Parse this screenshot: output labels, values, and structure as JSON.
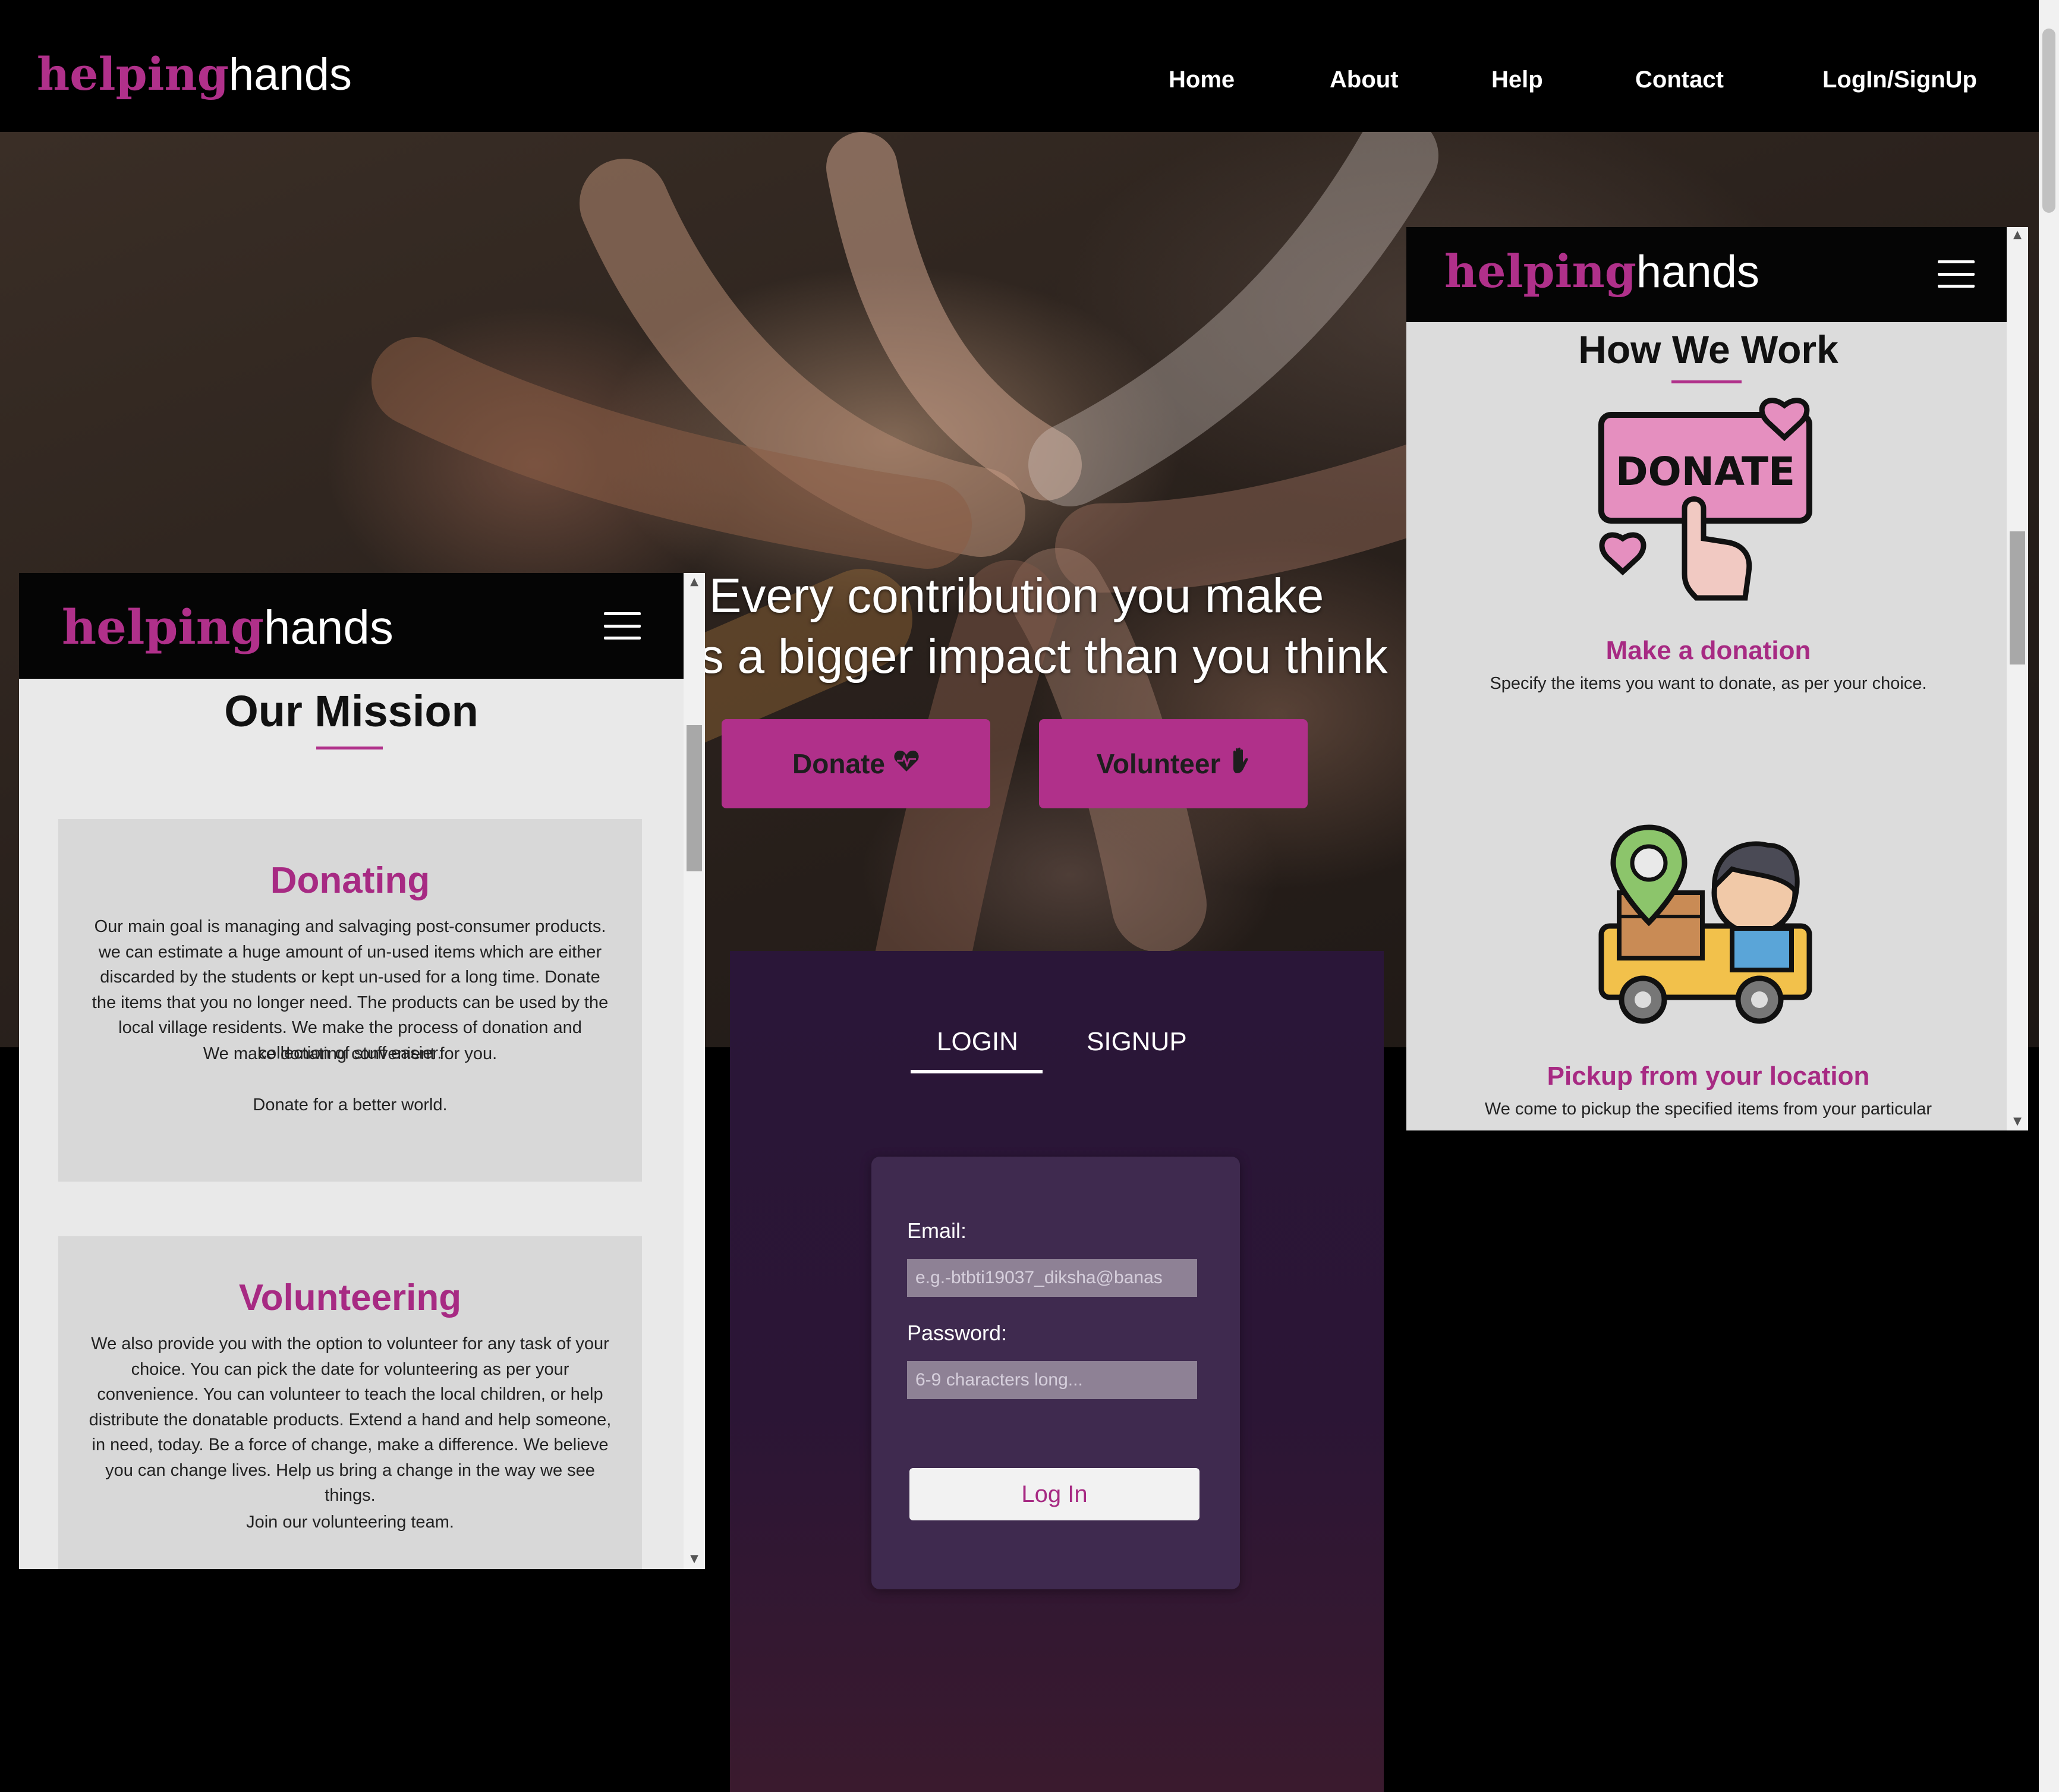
{
  "site": {
    "logo_part1": "helping",
    "logo_part2": "hands"
  },
  "nav": {
    "home": "Home",
    "about": "About",
    "help": "Help",
    "contact": "Contact",
    "login_signup": "LogIn/SignUp"
  },
  "hero": {
    "title_line1": "Every contribution you make",
    "title_line2": "has a bigger impact than you think",
    "donate_label": "Donate",
    "donate_icon": "heartbeat-icon",
    "volunteer_label": "Volunteer",
    "volunteer_icon": "raised-hand-icon"
  },
  "mission": {
    "title": "Our Mission",
    "cards": [
      {
        "title": "Donating",
        "body": "Our main goal is managing and salvaging post-consumer products. we can estimate a huge amount of un-used items which are either discarded by the students or kept un-used for a long time. Donate the items that you no longer need. The products can be used by the local village residents. We make the process of donation and collection of stuff easier.",
        "line2": "We make donating convenient for you.",
        "line3": "Donate for a better world."
      },
      {
        "title": "Volunteering",
        "body": "We also provide you with the option to volunteer for any task of your choice. You can pick the date for volunteering as per your convenience. You can volunteer to teach the local children, or help distribute the donatable products. Extend a hand and help someone, in need, today. Be a force of change, make a difference. We believe you can change lives. Help us bring a change in the way we see things.",
        "line3": "Join our volunteering team."
      }
    ]
  },
  "login": {
    "tab_login": "LOGIN",
    "tab_signup": "SIGNUP",
    "email_label": "Email:",
    "email_placeholder": "e.g.-btbti19037_diksha@banas",
    "password_label": "Password:",
    "password_placeholder": "6-9 characters long...",
    "submit_label": "Log In"
  },
  "how_we_work": {
    "title": "How We Work",
    "donate_sign": "DONATE",
    "steps": [
      {
        "title": "Make a donation",
        "desc": "Specify the items you want to donate, as per your choice."
      },
      {
        "title": "Pickup from your location",
        "desc": "We come to pickup the specified items from your particular"
      }
    ]
  },
  "colors": {
    "brand_magenta": "#b0308a",
    "login_bg": "#2a1638"
  }
}
